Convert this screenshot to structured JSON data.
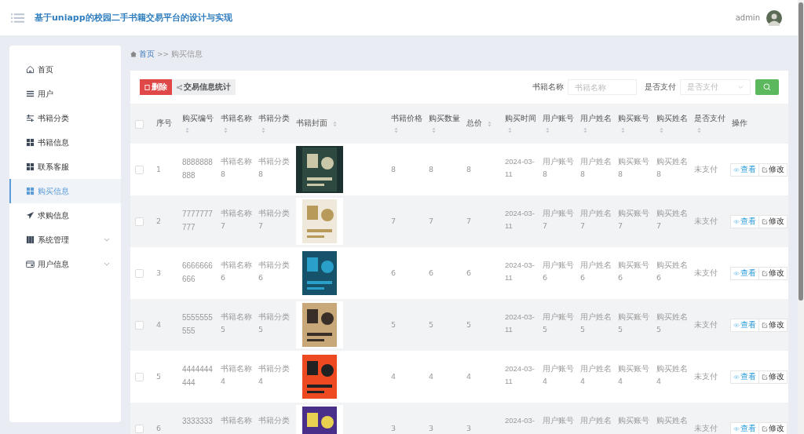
{
  "header": {
    "title": "基于uniapp的校园二手书籍交易平台的设计与实现",
    "user": "admin"
  },
  "sidebar": {
    "items": [
      {
        "label": "首页",
        "kind": "home",
        "selected": false
      },
      {
        "label": "用户",
        "kind": "list",
        "selected": false
      },
      {
        "label": "书籍分类",
        "kind": "sliders",
        "selected": false
      },
      {
        "label": "书籍信息",
        "kind": "grid",
        "selected": false
      },
      {
        "label": "联系客服",
        "kind": "grid",
        "selected": false
      },
      {
        "label": "购买信息",
        "kind": "grid",
        "selected": true
      },
      {
        "label": "求购信息",
        "kind": "plane",
        "selected": false
      },
      {
        "label": "系统管理",
        "kind": "book",
        "selected": false,
        "expanded": false
      },
      {
        "label": "用户信息",
        "kind": "card",
        "selected": false,
        "expanded": false
      }
    ]
  },
  "breadcrumb": {
    "home": "首页",
    "separator": ">>",
    "current": "购买信息"
  },
  "toolbar": {
    "delete": "删除",
    "stats": "交易信息统计"
  },
  "search": {
    "name_label": "书籍名称",
    "name_placeholder": "书籍名称",
    "paid_label": "是否支付",
    "paid_placeholder": "是否支付"
  },
  "table": {
    "all_checked": false,
    "columns": [
      {
        "label": "序号",
        "sortable": false
      },
      {
        "label": "购买编号",
        "sortable": true
      },
      {
        "label": "书籍名称",
        "sortable": true
      },
      {
        "label": "书籍分类",
        "sortable": true
      },
      {
        "label": "书籍封面",
        "sortable": true
      },
      {
        "label": "书籍价格",
        "sortable": true
      },
      {
        "label": "购买数量",
        "sortable": true
      },
      {
        "label": "总价",
        "sortable": true
      },
      {
        "label": "购买时间",
        "sortable": true
      },
      {
        "label": "用户账号",
        "sortable": true
      },
      {
        "label": "用户姓名",
        "sortable": true
      },
      {
        "label": "购买账号",
        "sortable": true
      },
      {
        "label": "购买姓名",
        "sortable": true
      },
      {
        "label": "是否支付",
        "sortable": true
      },
      {
        "label": "操作",
        "sortable": false
      }
    ],
    "rows": [
      {
        "checked": false,
        "cells": [
          "1",
          "8888888888",
          "书籍名称8",
          "书籍分类8",
          {
            "kind": "picture"
          },
          "8",
          "8",
          "8",
          "2024-03-11",
          "用户账号8",
          "用户姓名8",
          "购买账号8",
          "购买姓名8",
          "未支付"
        ],
        "actions": [
          {
            "kind": "view",
            "label": "查看"
          },
          {
            "kind": "edit",
            "label": "修改"
          }
        ]
      },
      {
        "checked": false,
        "cells": [
          "2",
          "7777777777",
          "书籍名称7",
          "书籍分类7",
          {
            "kind": "picture"
          },
          "7",
          "7",
          "7",
          "2024-03-11",
          "用户账号7",
          "用户姓名7",
          "购买账号7",
          "购买姓名7",
          "未支付"
        ],
        "actions": [
          {
            "kind": "view",
            "label": "查看"
          },
          {
            "kind": "edit",
            "label": "修改"
          }
        ]
      },
      {
        "checked": false,
        "cells": [
          "3",
          "6666666666",
          "书籍名称6",
          "书籍分类6",
          {
            "kind": "picture"
          },
          "6",
          "6",
          "6",
          "2024-03-11",
          "用户账号6",
          "用户姓名6",
          "购买账号6",
          "购买姓名6",
          "未支付"
        ],
        "actions": [
          {
            "kind": "view",
            "label": "查看"
          },
          {
            "kind": "edit",
            "label": "修改"
          }
        ]
      },
      {
        "checked": false,
        "cells": [
          "4",
          "5555555555",
          "书籍名称5",
          "书籍分类5",
          {
            "kind": "picture"
          },
          "5",
          "5",
          "5",
          "2024-03-11",
          "用户账号5",
          "用户姓名5",
          "购买账号5",
          "购买姓名5",
          "未支付"
        ],
        "actions": [
          {
            "kind": "view",
            "label": "查看"
          },
          {
            "kind": "edit",
            "label": "修改"
          }
        ]
      },
      {
        "checked": false,
        "cells": [
          "5",
          "4444444444",
          "书籍名称4",
          "书籍分类4",
          {
            "kind": "picture"
          },
          "4",
          "4",
          "4",
          "2024-03-11",
          "用户账号4",
          "用户姓名4",
          "购买账号4",
          "购买姓名4",
          "未支付"
        ],
        "actions": [
          {
            "kind": "view",
            "label": "查看"
          },
          {
            "kind": "edit",
            "label": "修改"
          }
        ]
      },
      {
        "checked": false,
        "cells": [
          "6",
          "3333333",
          "书籍名称",
          "书籍分类",
          {
            "kind": "picture"
          },
          "3",
          "3",
          "3",
          "2024-03-",
          "用户账号",
          "用户姓名",
          "购买账号",
          "购买姓名",
          "未支付"
        ],
        "actions": [
          {
            "kind": "view",
            "label": "查看"
          },
          {
            "kind": "edit",
            "label": "修改"
          }
        ]
      }
    ]
  }
}
